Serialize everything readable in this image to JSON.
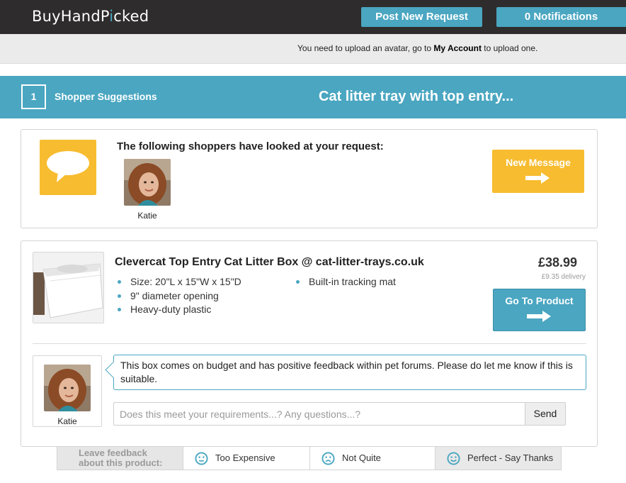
{
  "header": {
    "logo_part1": "BuyHandP",
    "logo_accent": "i",
    "logo_part2": "cked",
    "post_request_label": "Post New Request",
    "notifications_label": "0 Notifications"
  },
  "notice": {
    "prefix": "You need to upload an avatar, go to ",
    "link": "My Account",
    "suffix": " to upload one."
  },
  "step": {
    "number": "1",
    "label": "Shopper Suggestions",
    "request_title": "Cat litter tray with top entry..."
  },
  "shoppers": {
    "heading": "The following shoppers have looked at your request:",
    "list": [
      {
        "name": "Katie"
      }
    ],
    "new_message_label": "New Message"
  },
  "product": {
    "title": "Clevercat Top Entry Cat Litter Box @ cat-litter-trays.co.uk",
    "features_col1": [
      "Size: 20\"L x 15\"W x 15\"D",
      "9\" diameter opening",
      "Heavy-duty plastic"
    ],
    "features_col2": [
      "Built-in tracking mat"
    ],
    "price": "£38.99",
    "delivery": "£9.35 delivery",
    "go_to_label": "Go To Product"
  },
  "comment": {
    "author": "Katie",
    "text": "This box comes on budget and has positive feedback within pet forums. Please do let me know if this is suitable.",
    "reply_placeholder": "Does this meet your requirements...? Any questions...?",
    "send_label": "Send"
  },
  "feedback": {
    "label_line1": "Leave feedback",
    "label_line2": "about this product:",
    "options": [
      "Too Expensive",
      "Not Quite",
      "Perfect - Say Thanks"
    ]
  },
  "colors": {
    "brand_blue": "#4aa6c1",
    "accent_yellow": "#f7bc2f",
    "topbar_dark": "#2e2c2c"
  }
}
